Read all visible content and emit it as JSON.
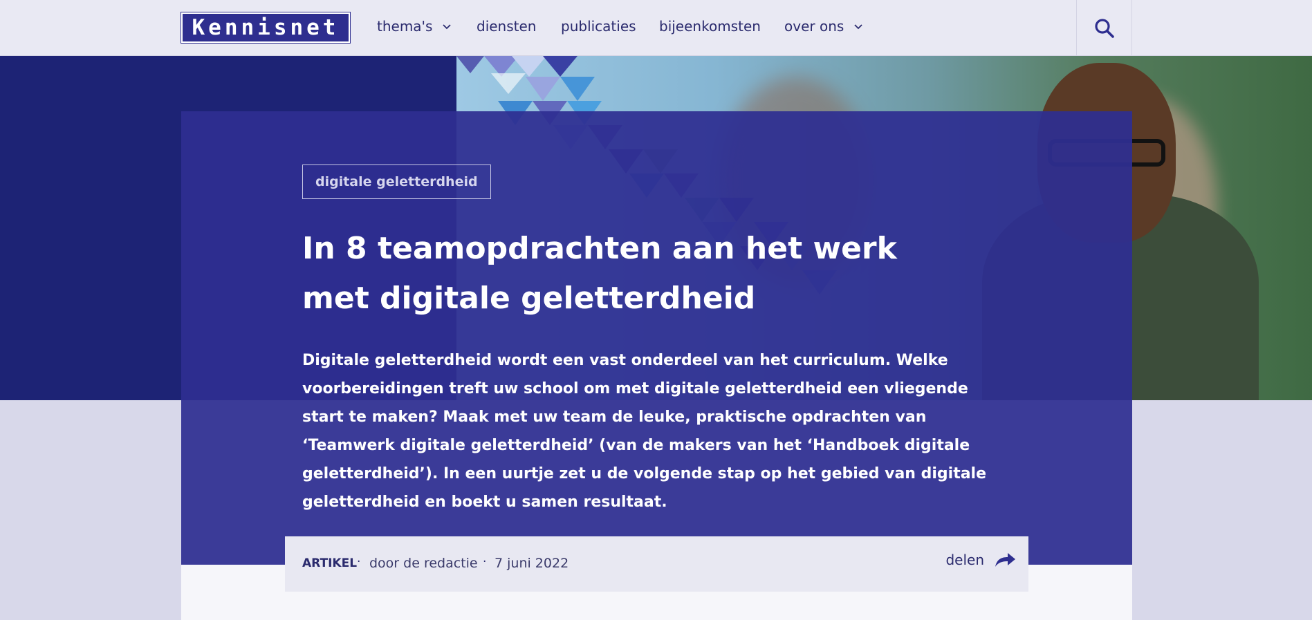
{
  "header": {
    "logo_text": "Kennisnet",
    "nav": [
      {
        "label": "thema's",
        "has_dropdown": true
      },
      {
        "label": "diensten",
        "has_dropdown": false
      },
      {
        "label": "publicaties",
        "has_dropdown": false
      },
      {
        "label": "bijeenkomsten",
        "has_dropdown": false
      },
      {
        "label": "over ons",
        "has_dropdown": true
      }
    ],
    "search_icon": "search-icon"
  },
  "hero": {
    "tag": "digitale geletterdheid",
    "title": "In 8 teamopdrachten aan het werk met digitale geletterdheid",
    "intro": "Digitale geletterdheid wordt een vast onderdeel van het curriculum. Welke voorbereidingen treft uw school om met digitale geletterdheid een vliegende start te maken? Maak met uw team de leuke, praktische opdrachten van ‘Teamwerk digitale geletterdheid’ (van de makers van het ‘Handboek digitale geletterdheid’). In een uurtje zet u de volgende stap op het gebied van digitale geletterdheid en boekt u samen resultaat."
  },
  "meta": {
    "type": "ARTIKEL",
    "separator": "·",
    "author": "door de redactie",
    "date": "7 juni 2022",
    "share_label": "delen",
    "share_icon": "share-arrow-icon"
  },
  "colors": {
    "brand": "#2e2e8f",
    "hero_dark": "#1d2375",
    "header_bg": "#e9e9f3",
    "page_bg": "#d8d8ea",
    "text_dark": "#2b2b6e"
  }
}
